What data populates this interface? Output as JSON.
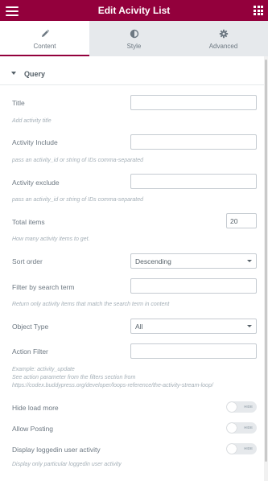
{
  "header": {
    "title": "Edit Acivity List"
  },
  "tabs": [
    {
      "label": "Content",
      "icon": "pencil-icon",
      "active": true
    },
    {
      "label": "Style",
      "icon": "half-circle-icon",
      "active": false
    },
    {
      "label": "Advanced",
      "icon": "gear-icon",
      "active": false
    }
  ],
  "section": {
    "title": "Query"
  },
  "fields": {
    "title": {
      "label": "Title",
      "value": "",
      "description": "Add activity title"
    },
    "include": {
      "label": "Activity Include",
      "value": "",
      "description": "pass an activity_id or string of IDs comma-separated"
    },
    "exclude": {
      "label": "Activity exclude",
      "value": "",
      "description": "pass an activity_id or string of IDs comma-separated"
    },
    "total": {
      "label": "Total items",
      "value": "20",
      "description": "How many activity items to get."
    },
    "sort": {
      "label": "Sort order",
      "value": "Descending"
    },
    "search": {
      "label": "Filter by search term",
      "value": "",
      "description": "Return only activity items that match the search term in content"
    },
    "object_type": {
      "label": "Object Type",
      "value": "All"
    },
    "action_filter": {
      "label": "Action Filter",
      "value": "",
      "desc1": "Example: activity_update",
      "desc2": "See action parameter from the filters section from",
      "desc3": "https://codex.buddypress.org/developer/loops-reference/the-activity-stream-loop/"
    },
    "hide_load_more": {
      "label": "Hide load more",
      "state": "HIDE"
    },
    "allow_posting": {
      "label": "Allow Posting",
      "state": "HIDE"
    },
    "loggedin": {
      "label": "Display loggedin user activity",
      "state": "HIDE",
      "description": "Display only particular loggedin user activity"
    }
  },
  "colors": {
    "brand": "#93003c",
    "tabbar": "#e6e9ec"
  }
}
